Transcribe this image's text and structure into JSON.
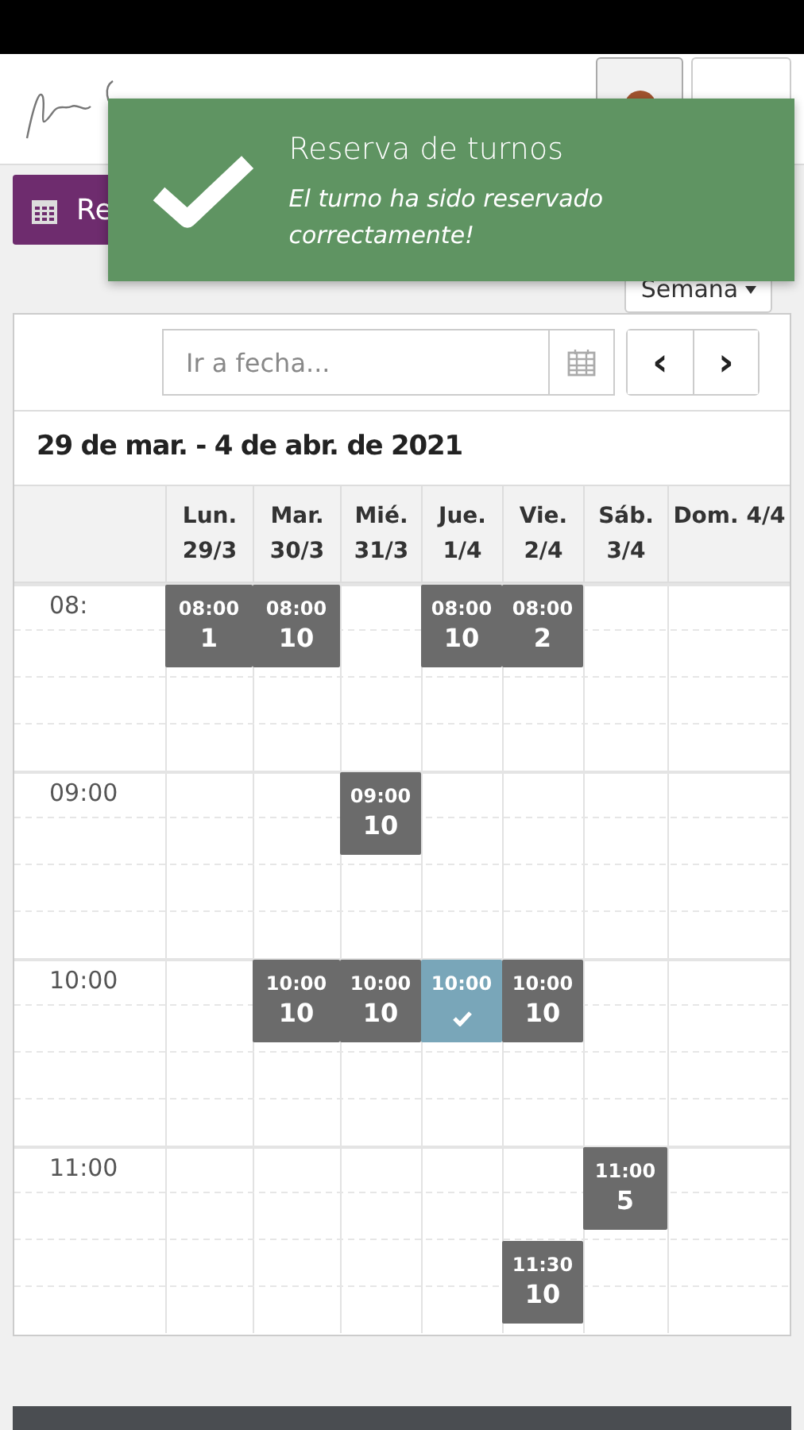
{
  "header": {
    "button_label": "Re"
  },
  "toast": {
    "title": "Reserva de turnos",
    "message": "El turno ha sido reservado correctamente!"
  },
  "view_select": {
    "value": "Semana"
  },
  "date_field": {
    "placeholder": "Ir a fecha..."
  },
  "nav_buttons": [
    "‹",
    "›"
  ],
  "range_title": "29 de mar. - 4 de abr. de 2021",
  "days": [
    "Lun. 29/3",
    "Mar. 30/3",
    "Mié. 31/3",
    "Jue. 1/4",
    "Vie. 2/4",
    "Sáb. 3/4",
    "Dom. 4/4"
  ],
  "rows": [
    {
      "time": "08:",
      "cells": [
        {
          "kind": "slot",
          "time": "08:00",
          "count": "1",
          "booked": false
        },
        {
          "kind": "slot",
          "time": "08:00",
          "count": "10",
          "booked": false
        },
        {
          "kind": "empty"
        },
        {
          "kind": "slot",
          "time": "08:00",
          "count": "10",
          "booked": false
        },
        {
          "kind": "slot",
          "time": "08:00",
          "count": "2",
          "booked": false
        },
        {
          "kind": "empty"
        },
        {
          "kind": "empty"
        }
      ]
    },
    {
      "cells": [
        {
          "kind": "empty"
        },
        {
          "kind": "empty"
        },
        {
          "kind": "empty"
        },
        {
          "kind": "empty"
        },
        {
          "kind": "empty"
        },
        {
          "kind": "empty"
        },
        {
          "kind": "empty"
        }
      ]
    },
    {
      "time": "09:00",
      "cells": [
        {
          "kind": "empty"
        },
        {
          "kind": "empty"
        },
        {
          "kind": "slot",
          "time": "09:00",
          "count": "10",
          "booked": false
        },
        {
          "kind": "empty"
        },
        {
          "kind": "empty"
        },
        {
          "kind": "empty"
        },
        {
          "kind": "empty"
        }
      ]
    },
    {
      "cells": [
        {
          "kind": "empty"
        },
        {
          "kind": "empty"
        },
        {
          "kind": "empty"
        },
        {
          "kind": "empty"
        },
        {
          "kind": "empty"
        },
        {
          "kind": "empty"
        },
        {
          "kind": "empty"
        }
      ]
    },
    {
      "time": "10:00",
      "cells": [
        {
          "kind": "empty"
        },
        {
          "kind": "slot",
          "time": "10:00",
          "count": "10",
          "booked": false
        },
        {
          "kind": "slot",
          "time": "10:00",
          "count": "10",
          "booked": false
        },
        {
          "kind": "slot",
          "time": "10:00",
          "booked": true
        },
        {
          "kind": "slot",
          "time": "10:00",
          "count": "10",
          "booked": false
        },
        {
          "kind": "empty"
        },
        {
          "kind": "empty"
        }
      ]
    },
    {
      "cells": [
        {
          "kind": "empty"
        },
        {
          "kind": "empty"
        },
        {
          "kind": "empty"
        },
        {
          "kind": "empty"
        },
        {
          "kind": "empty"
        },
        {
          "kind": "empty"
        },
        {
          "kind": "empty"
        }
      ]
    },
    {
      "time": "11:00",
      "cells": [
        {
          "kind": "empty"
        },
        {
          "kind": "empty"
        },
        {
          "kind": "empty"
        },
        {
          "kind": "empty"
        },
        {
          "kind": "empty"
        },
        {
          "kind": "slot",
          "time": "11:00",
          "count": "5",
          "booked": false
        },
        {
          "kind": "empty"
        }
      ]
    },
    {
      "cells": [
        {
          "kind": "empty"
        },
        {
          "kind": "empty"
        },
        {
          "kind": "empty"
        },
        {
          "kind": "empty"
        },
        {
          "kind": "slot",
          "time": "11:30",
          "count": "10",
          "booked": false
        },
        {
          "kind": "empty"
        },
        {
          "kind": "empty"
        }
      ]
    }
  ]
}
